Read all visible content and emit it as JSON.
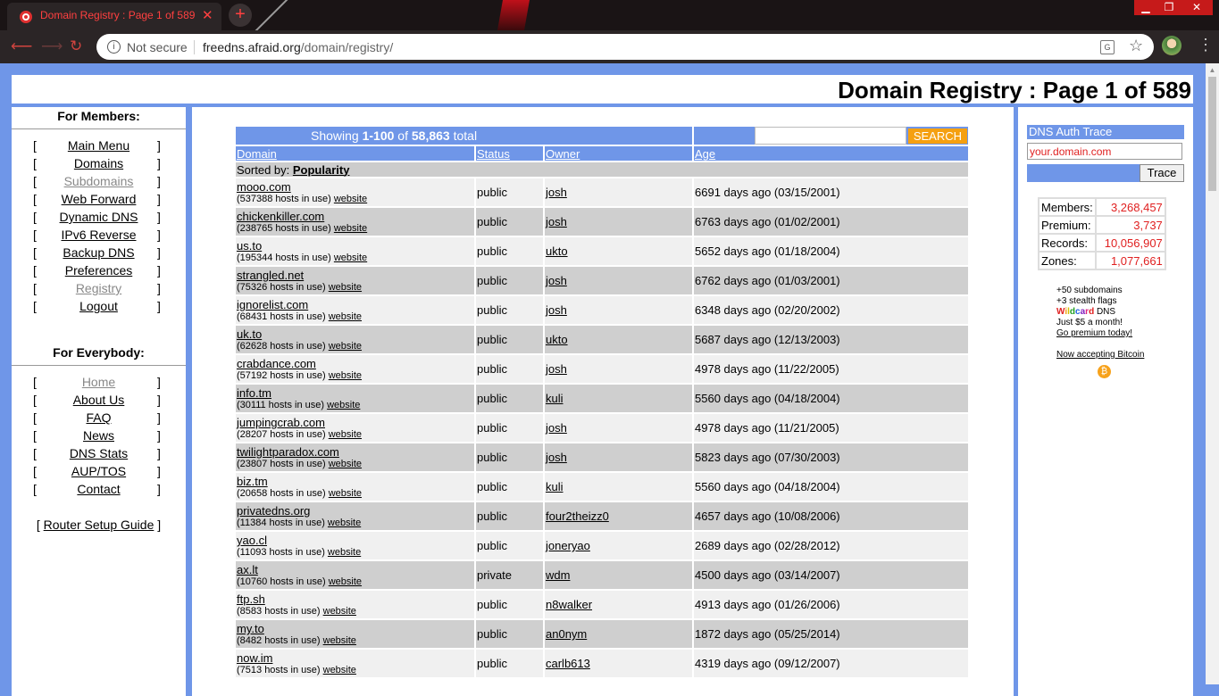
{
  "browser": {
    "tab_title": "Domain Registry : Page 1 of 589",
    "security": "Not secure",
    "url_host": "freedns.afraid.org",
    "url_path": "/domain/registry/"
  },
  "page": {
    "title": "Domain Registry : Page 1 of 589"
  },
  "left": {
    "members_heading": "For Members:",
    "members": [
      {
        "label": "Main Menu"
      },
      {
        "label": "Domains"
      },
      {
        "label": "Subdomains"
      },
      {
        "label": "Web Forward"
      },
      {
        "label": "Dynamic DNS"
      },
      {
        "label": "IPv6 Reverse"
      },
      {
        "label": "Backup DNS"
      },
      {
        "label": "Preferences"
      },
      {
        "label": "Registry"
      },
      {
        "label": "Logout"
      }
    ],
    "everybody_heading": "For Everybody:",
    "everybody": [
      {
        "label": "Home"
      },
      {
        "label": "About Us"
      },
      {
        "label": "FAQ"
      },
      {
        "label": "News"
      },
      {
        "label": "DNS Stats"
      },
      {
        "label": "AUP/TOS"
      },
      {
        "label": "Contact"
      }
    ],
    "router_guide": "Router Setup Guide"
  },
  "registry": {
    "showing_prefix": "Showing ",
    "range": "1-100",
    "of": " of ",
    "total": "58,863",
    "total_suffix": " total",
    "search_label": "SEARCH",
    "headers": {
      "domain": "Domain",
      "status": "Status",
      "owner": "Owner",
      "age": "Age"
    },
    "sorted_prefix": "Sorted by: ",
    "sorted_by": "Popularity",
    "website_label": "website",
    "rows": [
      {
        "domain": "mooo.com",
        "hosts": "(537388 hosts in use)",
        "status": "public",
        "owner": "josh",
        "age": "6691 days ago (03/15/2001)"
      },
      {
        "domain": "chickenkiller.com",
        "hosts": "(238765 hosts in use)",
        "status": "public",
        "owner": "josh",
        "age": "6763 days ago (01/02/2001)"
      },
      {
        "domain": "us.to",
        "hosts": "(195344 hosts in use)",
        "status": "public",
        "owner": "ukto",
        "age": "5652 days ago (01/18/2004)"
      },
      {
        "domain": "strangled.net",
        "hosts": "(75326 hosts in use)",
        "status": "public",
        "owner": "josh",
        "age": "6762 days ago (01/03/2001)"
      },
      {
        "domain": "ignorelist.com",
        "hosts": "(68431 hosts in use)",
        "status": "public",
        "owner": "josh",
        "age": "6348 days ago (02/20/2002)"
      },
      {
        "domain": "uk.to",
        "hosts": "(62628 hosts in use)",
        "status": "public",
        "owner": "ukto",
        "age": "5687 days ago (12/13/2003)"
      },
      {
        "domain": "crabdance.com",
        "hosts": "(57192 hosts in use)",
        "status": "public",
        "owner": "josh",
        "age": "4978 days ago (11/22/2005)"
      },
      {
        "domain": "info.tm",
        "hosts": "(30111 hosts in use)",
        "status": "public",
        "owner": "kuli",
        "age": "5560 days ago (04/18/2004)"
      },
      {
        "domain": "jumpingcrab.com",
        "hosts": "(28207 hosts in use)",
        "status": "public",
        "owner": "josh",
        "age": "4978 days ago (11/21/2005)"
      },
      {
        "domain": "twilightparadox.com",
        "hosts": "(23807 hosts in use)",
        "status": "public",
        "owner": "josh",
        "age": "5823 days ago (07/30/2003)"
      },
      {
        "domain": "biz.tm",
        "hosts": "(20658 hosts in use)",
        "status": "public",
        "owner": "kuli",
        "age": "5560 days ago (04/18/2004)"
      },
      {
        "domain": "privatedns.org",
        "hosts": "(11384 hosts in use)",
        "status": "public",
        "owner": "four2theizz0",
        "age": "4657 days ago (10/08/2006)"
      },
      {
        "domain": "yao.cl",
        "hosts": "(11093 hosts in use)",
        "status": "public",
        "owner": "joneryao",
        "age": "2689 days ago (02/28/2012)"
      },
      {
        "domain": "ax.lt",
        "hosts": "(10760 hosts in use)",
        "status": "private",
        "owner": "wdm",
        "age": "4500 days ago (03/14/2007)"
      },
      {
        "domain": "ftp.sh",
        "hosts": "(8583 hosts in use)",
        "status": "public",
        "owner": "n8walker",
        "age": "4913 days ago (01/26/2006)"
      },
      {
        "domain": "my.to",
        "hosts": "(8482 hosts in use)",
        "status": "public",
        "owner": "an0nym",
        "age": "1872 days ago (05/25/2014)"
      },
      {
        "domain": "now.im",
        "hosts": "(7513 hosts in use)",
        "status": "public",
        "owner": "carlb613",
        "age": "4319 days ago (09/12/2007)"
      }
    ]
  },
  "right": {
    "trace_heading": "DNS Auth Trace",
    "trace_placeholder": "your.domain.com",
    "trace_button": "Trace",
    "stats": [
      {
        "label": "Members:",
        "value": "3,268,457"
      },
      {
        "label": "Premium:",
        "value": "3,737"
      },
      {
        "label": "Records:",
        "value": "10,056,907"
      },
      {
        "label": "Zones:",
        "value": "1,077,661"
      }
    ],
    "promo_1": "+50 subdomains",
    "promo_2": "+3 stealth flags",
    "promo_wildcard": "Wildcard",
    "promo_dns": " DNS",
    "promo_3": "Just $5 a month!",
    "promo_link": "Go premium today!",
    "bitcoin_text": "Now accepting Bitcoin"
  },
  "colors": {
    "accent": "#6f96e8",
    "search": "#f5a011",
    "stat_value": "#e02020"
  }
}
